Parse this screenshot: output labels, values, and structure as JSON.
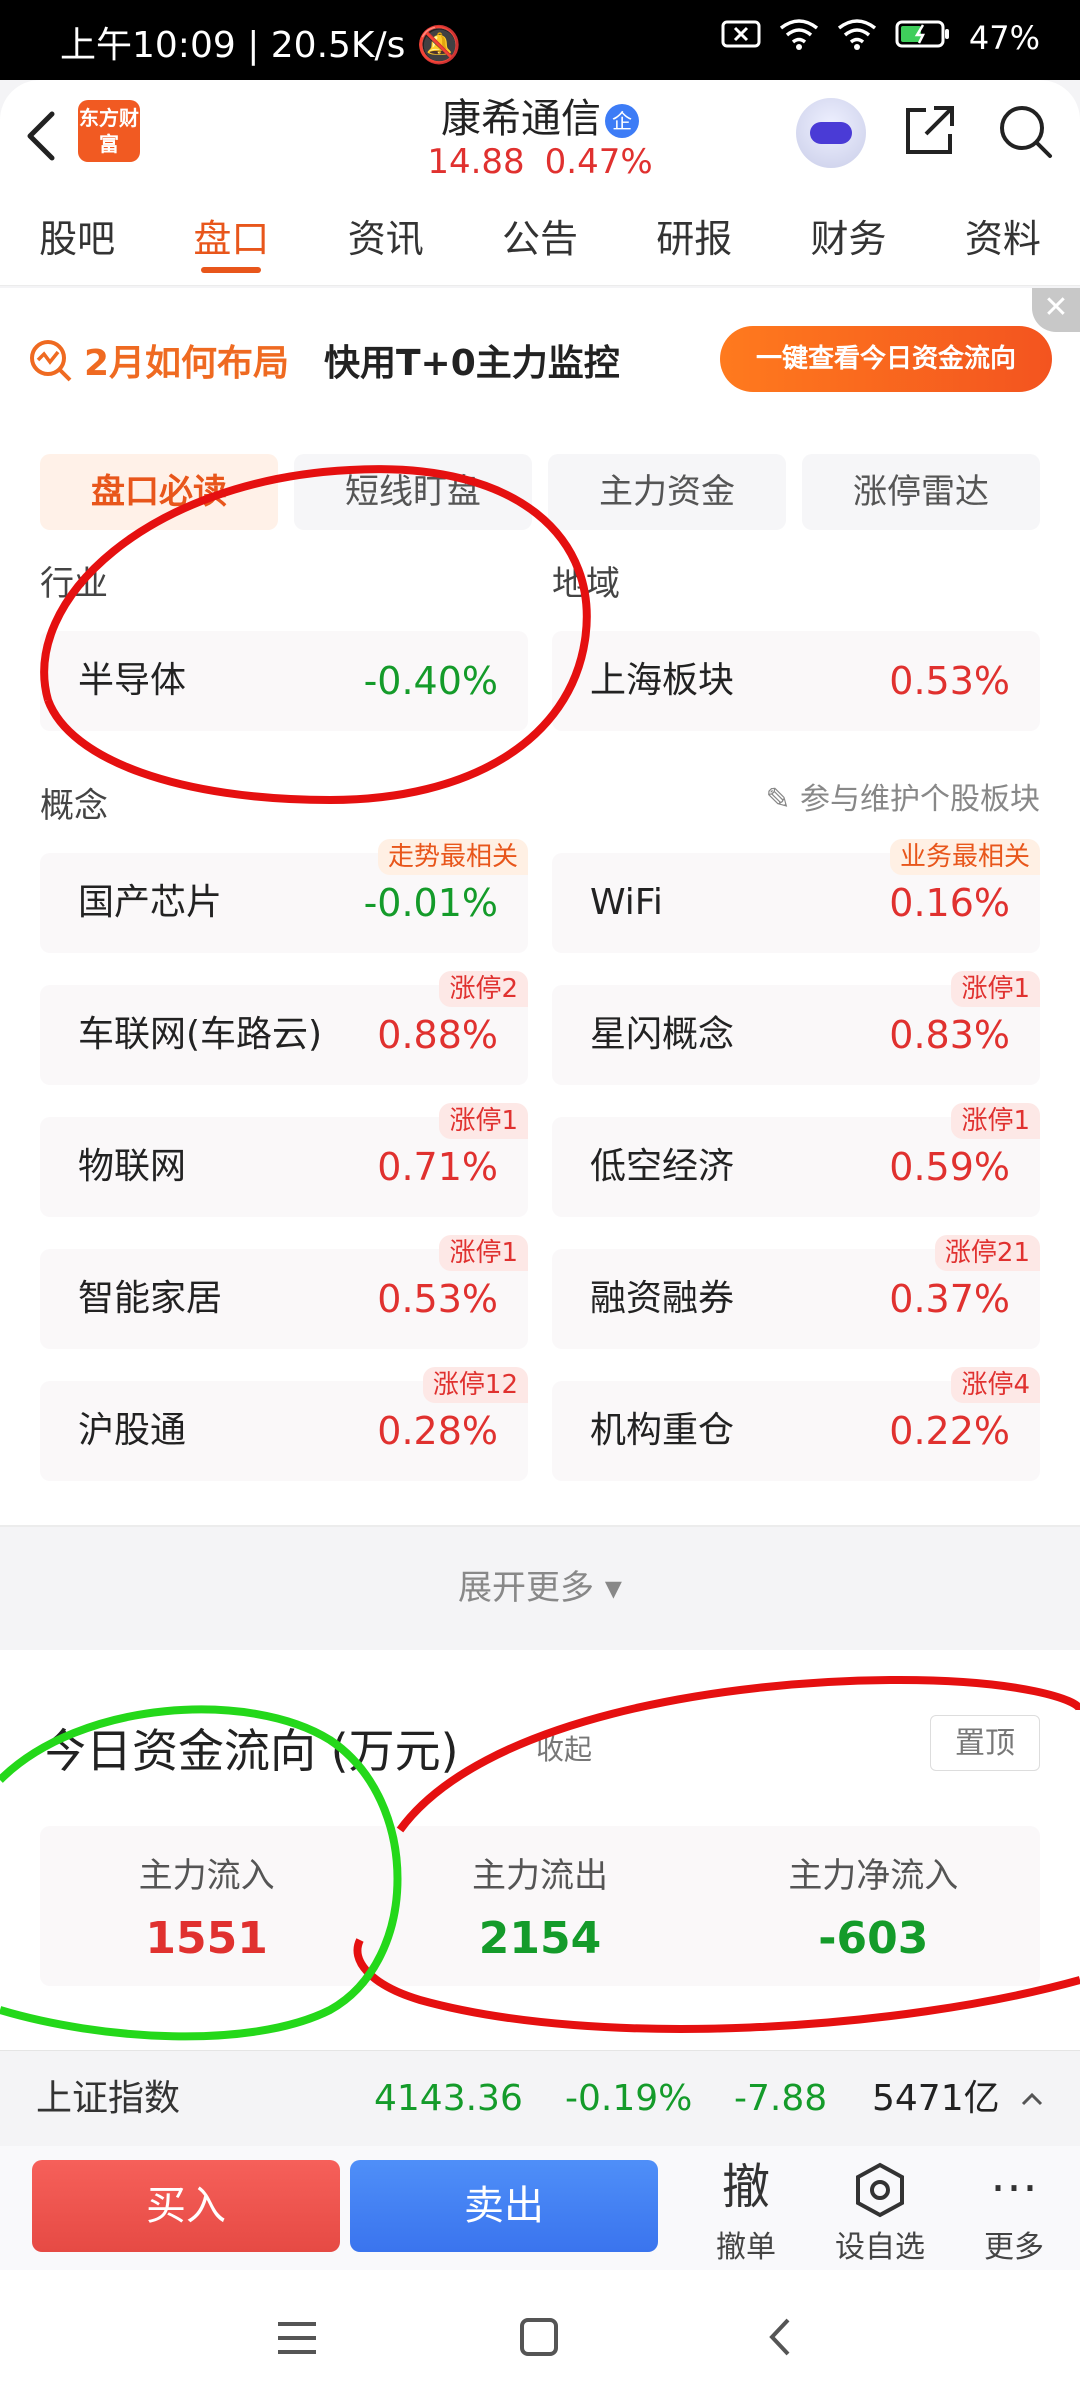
{
  "status_bar": {
    "time": "上午10:09",
    "speed": "20.5K/s",
    "battery": "47%"
  },
  "header": {
    "logo_text": "东方财富",
    "stock_name": "康希通信",
    "verify_badge": "企",
    "price": "14.88",
    "change": "0.47%"
  },
  "tabs": [
    "股吧",
    "盘口",
    "资讯",
    "公告",
    "研报",
    "财务",
    "资料"
  ],
  "promo": {
    "title": "2月如何布局",
    "subtitle": "快用T+0主力监控",
    "button": "一键查看今日资金流向"
  },
  "subtabs": [
    "盘口必读",
    "短线盯盘",
    "主力资金",
    "涨停雷达"
  ],
  "industry": {
    "label": "行业",
    "name": "半导体",
    "pct": "-0.40%"
  },
  "region": {
    "label": "地域",
    "name": "上海板块",
    "pct": "0.53%"
  },
  "concept": {
    "label": "概念",
    "maintain_link": "参与维护个股板块",
    "items": [
      {
        "name": "国产芯片",
        "pct": "-0.01%",
        "tag": "走势最相关"
      },
      {
        "name": "WiFi",
        "pct": "0.16%",
        "tag": "业务最相关"
      },
      {
        "name": "车联网(车路云)",
        "pct": "0.88%",
        "tag": "涨停2"
      },
      {
        "name": "星闪概念",
        "pct": "0.83%",
        "tag": "涨停1"
      },
      {
        "name": "物联网",
        "pct": "0.71%",
        "tag": "涨停1"
      },
      {
        "name": "低空经济",
        "pct": "0.59%",
        "tag": "涨停1"
      },
      {
        "name": "智能家居",
        "pct": "0.53%",
        "tag": "涨停1"
      },
      {
        "name": "融资融券",
        "pct": "0.37%",
        "tag": "涨停21"
      },
      {
        "name": "沪股通",
        "pct": "0.28%",
        "tag": "涨停12"
      },
      {
        "name": "机构重仓",
        "pct": "0.22%",
        "tag": "涨停4"
      }
    ]
  },
  "expand_more": "展开更多",
  "fund_flow": {
    "title": "今日资金流向 (万元)",
    "collapse": "收起",
    "pin": "置顶",
    "inflow_label": "主力流入",
    "inflow": "1551",
    "outflow_label": "主力流出",
    "outflow": "2154",
    "net_label": "主力净流入",
    "net": "-603"
  },
  "index_bar": {
    "name": "上证指数",
    "value": "4143.36",
    "pct": "-0.19%",
    "change": "-7.88",
    "volume": "5471亿"
  },
  "actions": {
    "buy": "买入",
    "sell": "卖出",
    "cancel_icon": "撤",
    "cancel": "撤单",
    "watch": "设自选",
    "more": "更多"
  },
  "colors": {
    "up": "#e0312f",
    "down": "#149b2a",
    "accent": "#e8561b",
    "buy": "#ec514b",
    "sell": "#4282f4"
  }
}
